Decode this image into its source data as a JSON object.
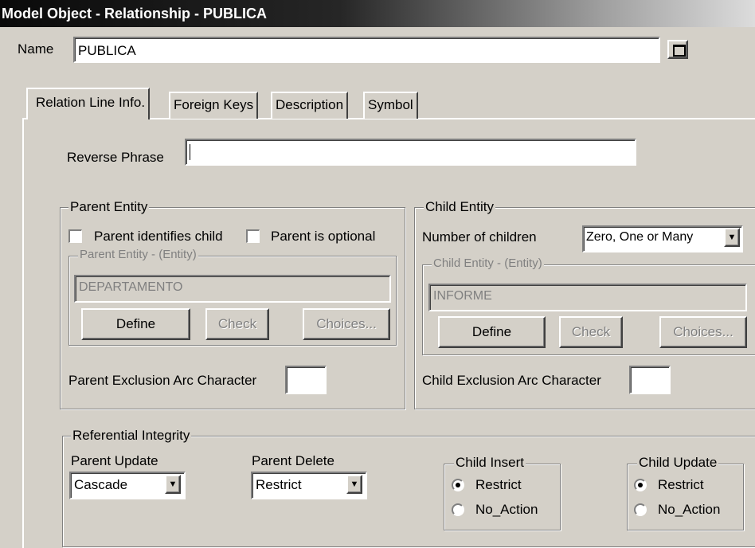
{
  "window": {
    "title": "Model Object - Relationship - PUBLICA"
  },
  "name_field": {
    "label": "Name",
    "value": "PUBLICA"
  },
  "tabs": [
    {
      "label": "Relation Line Info."
    },
    {
      "label": "Foreign Keys"
    },
    {
      "label": "Description"
    },
    {
      "label": "Symbol"
    }
  ],
  "reverse_phrase": {
    "label": "Reverse Phrase",
    "value": ""
  },
  "parent_entity": {
    "group_label": "Parent Entity",
    "identifies_child_label": "Parent identifies child",
    "identifies_child_checked": false,
    "is_optional_label": "Parent is optional",
    "is_optional_checked": false,
    "entity_group_label": "Parent Entity - (Entity)",
    "entity_value": "DEPARTAMENTO",
    "define_label": "Define",
    "check_label": "Check",
    "choices_label": "Choices...",
    "exclusion_label": "Parent Exclusion Arc Character",
    "exclusion_value": ""
  },
  "child_entity": {
    "group_label": "Child Entity",
    "num_children_label": "Number of children",
    "num_children_value": "Zero, One or Many",
    "entity_group_label": "Child Entity - (Entity)",
    "entity_value": "INFORME",
    "define_label": "Define",
    "check_label": "Check",
    "choices_label": "Choices...",
    "exclusion_label": "Child Exclusion Arc Character",
    "exclusion_value": ""
  },
  "referential_integrity": {
    "group_label": "Referential Integrity",
    "parent_update_label": "Parent Update",
    "parent_update_value": "Cascade",
    "parent_delete_label": "Parent Delete",
    "parent_delete_value": "Restrict",
    "child_insert": {
      "label": "Child Insert",
      "opt1": "Restrict",
      "opt2": "No_Action",
      "selected": "Restrict"
    },
    "child_update": {
      "label": "Child Update",
      "opt1": "Restrict",
      "opt2": "No_Action",
      "selected": "Restrict"
    }
  },
  "icons": {
    "maximize": "restore-box-icon",
    "dropdown": "down-arrow-icon"
  }
}
